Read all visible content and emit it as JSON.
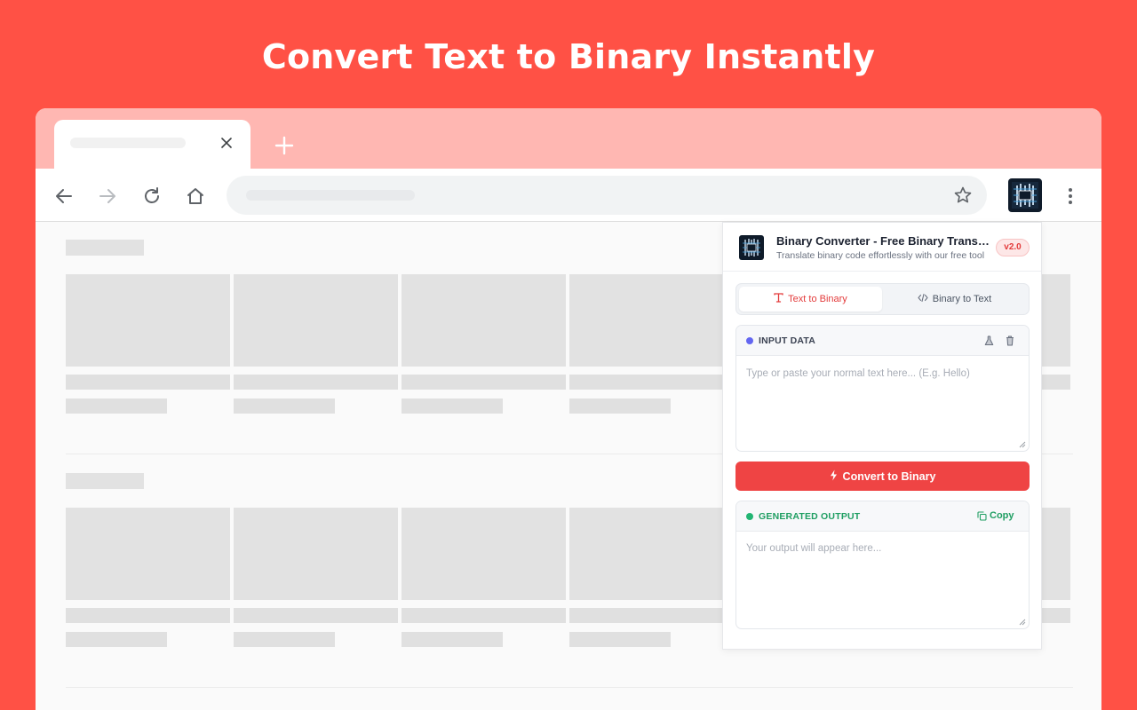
{
  "headline": "Convert Text to Binary Instantly",
  "colors": {
    "background": "#ff5145",
    "accent": "#ef4444",
    "input_dot": "#6366f1",
    "output_green": "#22b573"
  },
  "browser": {
    "tab_close_icon": "close-icon",
    "new_tab_icon": "plus-icon"
  },
  "extension": {
    "title": "Binary Converter - Free Binary Translator",
    "subtitle": "Translate binary code effortlessly with our free tool",
    "version": "v2.0",
    "tabs": [
      {
        "label": "Text to Binary",
        "icon": "text-icon",
        "active": true
      },
      {
        "label": "Binary to Text",
        "icon": "code-icon",
        "active": false
      }
    ],
    "input": {
      "label": "INPUT DATA",
      "placeholder": "Type or paste your normal text here... (E.g. Hello)"
    },
    "convert_label": "Convert to Binary",
    "output": {
      "label": "GENERATED OUTPUT",
      "copy_label": "Copy",
      "placeholder": "Your output will appear here..."
    }
  }
}
